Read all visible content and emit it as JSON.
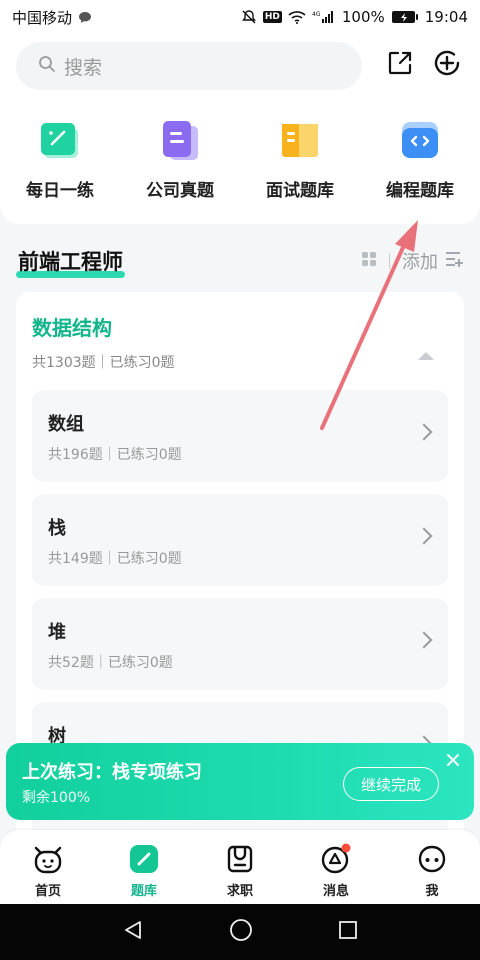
{
  "status": {
    "carrier": "中国移动",
    "battery": "100%",
    "time": "19:04",
    "net": "4G"
  },
  "search": {
    "placeholder": "搜索"
  },
  "quick_entries": [
    {
      "label": "每日一练",
      "color": "#1fd2a0"
    },
    {
      "label": "公司真题",
      "color": "#8b6cf0"
    },
    {
      "label": "面试题库",
      "color": "#f8b21d"
    },
    {
      "label": "编程题库",
      "color": "#3d8ff5"
    }
  ],
  "section": {
    "title": "前端工程师",
    "add_label": "添加"
  },
  "category": {
    "title": "数据结构",
    "stats": "共1303题｜已练习0题"
  },
  "sub_items": [
    {
      "name": "数组",
      "stats": "共196题｜已练习0题"
    },
    {
      "name": "栈",
      "stats": "共149题｜已练习0题"
    },
    {
      "name": "堆",
      "stats": "共52题｜已练习0题"
    },
    {
      "name": "树",
      "stats": ""
    }
  ],
  "toast": {
    "title": "上次练习：栈专项练习",
    "subtitle": "剩余100%",
    "button": "继续完成"
  },
  "tabs": [
    {
      "label": "首页"
    },
    {
      "label": "题库"
    },
    {
      "label": "求职"
    },
    {
      "label": "消息"
    },
    {
      "label": "我"
    }
  ],
  "colors": {
    "accent": "#13b58c",
    "badge": "#ff4d3a",
    "arrow": "#e8717a"
  }
}
